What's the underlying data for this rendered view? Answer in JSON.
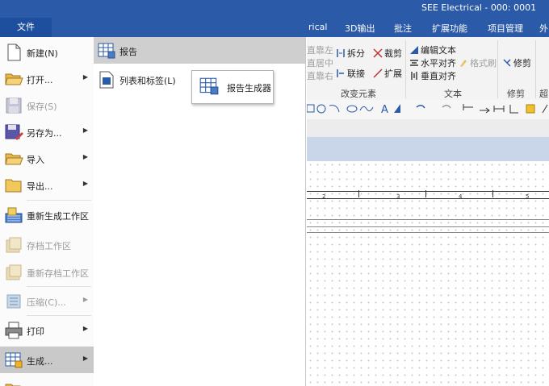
{
  "app": {
    "title": "SEE Electrical - 000: 0001"
  },
  "ribbon_tabs": [
    "rical",
    "3D输出",
    "批注",
    "扩展功能",
    "项目管理",
    "外"
  ],
  "file_tab": "文件",
  "ribbon": {
    "align_left": "直靠左",
    "align_center": "直居中",
    "align_right": "直靠右",
    "split": "拆分",
    "trim": "裁剪",
    "join": "联接",
    "extend": "扩展",
    "group_change": "改变元素",
    "edit_text": "编辑文本",
    "horiz_align": "水平对齐",
    "format_brush": "格式刷",
    "vert_align": "垂直对齐",
    "group_text": "文本",
    "modify": "修剪",
    "group_modify": "修剪",
    "group_more": "超"
  },
  "menu": {
    "items": [
      {
        "label": "新建(N)",
        "arrow": "",
        "disabled": false
      },
      {
        "label": "打开...",
        "arrow": "▶",
        "disabled": false
      },
      {
        "label": "保存(S)",
        "arrow": "",
        "disabled": true
      },
      {
        "label": "另存为...",
        "arrow": "▶",
        "disabled": false
      },
      {
        "label": "导入",
        "arrow": "▶",
        "disabled": false
      },
      {
        "label": "导出...",
        "arrow": "▶",
        "disabled": false
      },
      {
        "label": "重新生成工作区",
        "arrow": "",
        "disabled": false
      },
      {
        "label": "存档工作区",
        "arrow": "",
        "disabled": true
      },
      {
        "label": "重新存档工作区",
        "arrow": "",
        "disabled": true
      },
      {
        "label": "压缩(C)...",
        "arrow": "▶",
        "disabled": true
      },
      {
        "label": "打印",
        "arrow": "▶",
        "disabled": false
      },
      {
        "label": "生成...",
        "arrow": "▶",
        "disabled": false
      }
    ]
  },
  "submenu": {
    "header": "报告",
    "item": "列表和标签(L)",
    "popup": "报告生成器"
  },
  "column_numbers": [
    "2",
    "3",
    "4",
    "5"
  ]
}
